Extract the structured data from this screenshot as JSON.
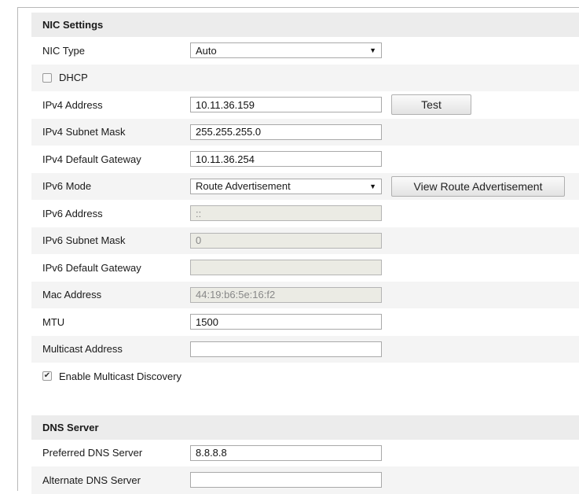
{
  "nic": {
    "header": "NIC Settings",
    "nic_type_label": "NIC Type",
    "nic_type_value": "Auto",
    "dhcp_label": "DHCP",
    "dhcp_checked": false,
    "ipv4_address_label": "IPv4 Address",
    "ipv4_address": "10.11.36.159",
    "test_label": "Test",
    "ipv4_mask_label": "IPv4 Subnet Mask",
    "ipv4_mask": "255.255.255.0",
    "ipv4_gateway_label": "IPv4 Default Gateway",
    "ipv4_gateway": "10.11.36.254",
    "ipv6_mode_label": "IPv6 Mode",
    "ipv6_mode_value": "Route Advertisement",
    "view_ra_label": "View Route Advertisement",
    "ipv6_address_label": "IPv6 Address",
    "ipv6_address": "::",
    "ipv6_mask_label": "IPv6 Subnet Mask",
    "ipv6_mask": "0",
    "ipv6_gateway_label": "IPv6 Default Gateway",
    "ipv6_gateway": "",
    "mac_label": "Mac Address",
    "mac": "44:19:b6:5e:16:f2",
    "mtu_label": "MTU",
    "mtu": "1500",
    "multicast_label": "Multicast Address",
    "multicast": "",
    "multicast_discovery_label": "Enable Multicast Discovery",
    "multicast_discovery_checked": true
  },
  "dns": {
    "header": "DNS Server",
    "preferred_label": "Preferred DNS Server",
    "preferred": "8.8.8.8",
    "alternate_label": "Alternate DNS Server",
    "alternate": ""
  },
  "icons": {
    "select_arrow": "dropdown-arrow-icon",
    "check": "checkmark-icon"
  }
}
